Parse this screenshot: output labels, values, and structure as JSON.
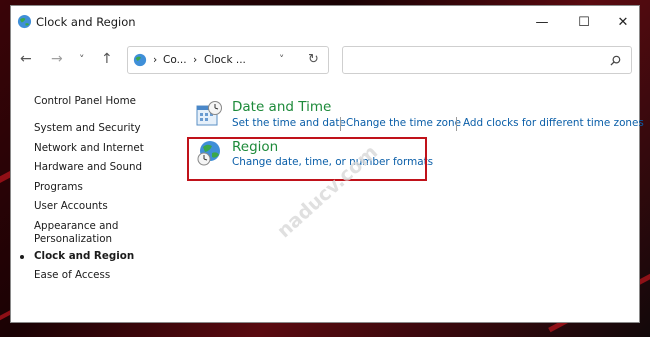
{
  "window": {
    "title": "Clock and Region"
  },
  "controls": {
    "minimize": "—",
    "maximize": "☐",
    "close": "✕"
  },
  "nav": {
    "back": "←",
    "forward": "→",
    "recent": "˅",
    "up": "↑",
    "refresh": "↻"
  },
  "address": {
    "crumbs": [
      "Co...",
      "Clock ..."
    ],
    "separator": "›"
  },
  "search": {
    "placeholder": ""
  },
  "sidebar": {
    "home": "Control Panel Home",
    "items": [
      {
        "label": "System and Security",
        "active": false
      },
      {
        "label": "Network and Internet",
        "active": false
      },
      {
        "label": "Hardware and Sound",
        "active": false
      },
      {
        "label": "Programs",
        "active": false
      },
      {
        "label": "User Accounts",
        "active": false
      },
      {
        "label": "Appearance and",
        "label2": "Personalization",
        "active": false
      },
      {
        "label": "Clock and Region",
        "active": true
      },
      {
        "label": "Ease of Access",
        "active": false
      }
    ]
  },
  "categories": [
    {
      "title": "Date and Time",
      "icon": "calendar-clock-icon",
      "links": [
        "Set the time and date",
        "Change the time zone",
        "Add clocks for different time zones"
      ]
    },
    {
      "title": "Region",
      "icon": "globe-clock-icon",
      "links": [
        "Change date, time, or number formats"
      ],
      "highlighted": true
    }
  ],
  "watermark": {
    "text": "naducv.com"
  },
  "colors": {
    "accent_green": "#1d8a3a",
    "link_blue": "#0a5ea8",
    "highlight_red": "#c0121a"
  }
}
